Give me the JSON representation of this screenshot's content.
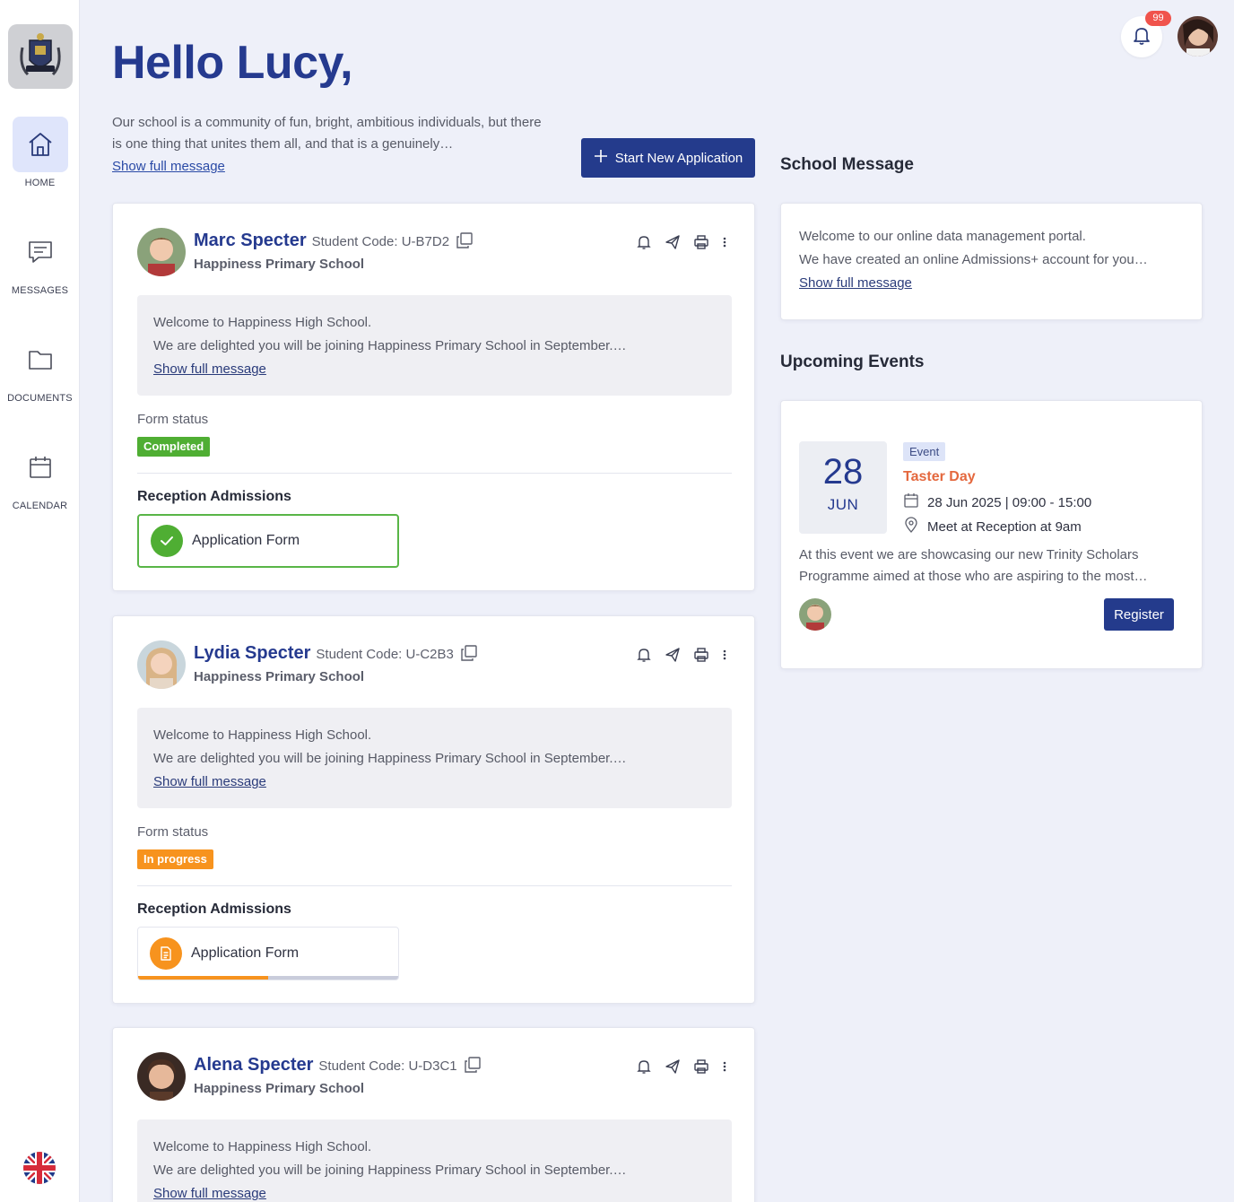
{
  "sidebar": {
    "items": [
      {
        "label": "HOME",
        "icon": "home-icon"
      },
      {
        "label": "MESSAGES",
        "icon": "message-icon"
      },
      {
        "label": "DOCUMENTS",
        "icon": "folder-icon"
      },
      {
        "label": "CALENDAR",
        "icon": "calendar-icon"
      }
    ],
    "language_flag": "uk-flag-icon"
  },
  "header": {
    "notification_count": "99",
    "greeting": "Hello Lucy,",
    "intro_text": "Our school is a community of fun, bright, ambitious individuals, but there is one thing that unites them all, and that is a genuinely…",
    "show_full": "Show full message",
    "start_button": "Start New Application"
  },
  "students": [
    {
      "name": "Marc Specter",
      "code": "Student Code: U-B7D2",
      "school": "Happiness Primary School",
      "msg_line1": "Welcome to Happiness High School.",
      "msg_line2": "We are delighted you will be joining Happiness Primary School in September.…",
      "show_full": "Show full message",
      "form_status_label": "Form status",
      "status": "Completed",
      "admissions_title": "Reception Admissions",
      "form_label": "Application Form"
    },
    {
      "name": "Lydia Specter",
      "code": "Student Code: U-C2B3",
      "school": "Happiness Primary School",
      "msg_line1": "Welcome to Happiness High School.",
      "msg_line2": "We are delighted you will be joining Happiness Primary School in September.…",
      "show_full": "Show full message",
      "form_status_label": "Form status",
      "status": "In progress",
      "admissions_title": "Reception Admissions",
      "form_label": "Application Form",
      "progress": 0.5
    },
    {
      "name": "Alena Specter",
      "code": "Student Code: U-D3C1",
      "school": "Happiness Primary School",
      "msg_line1": "Welcome to Happiness High School.",
      "msg_line2": "We are delighted you will be joining Happiness Primary School in September.…",
      "show_full": "Show full message"
    }
  ],
  "school_message": {
    "title": "School Message",
    "line1": "Welcome to our online data management portal.",
    "line2": "We have created an online Admissions+ account for you…",
    "show_full": "Show full message"
  },
  "events": {
    "title": "Upcoming Events",
    "item": {
      "day": "28",
      "month": "JUN",
      "tag": "Event",
      "name": "Taster Day",
      "datetime": "28 Jun 2025 | 09:00 - 15:00",
      "location": "Meet at Reception at 9am",
      "description": "At this event we are showcasing our new Trinity Scholars Programme aimed at those who are aspiring to the most…",
      "register": "Register"
    }
  },
  "colors": {
    "brand": "#243b8c",
    "completed": "#4fae33",
    "in_progress": "#f7931e",
    "event_accent": "#e4683e",
    "notification": "#f0534c"
  }
}
